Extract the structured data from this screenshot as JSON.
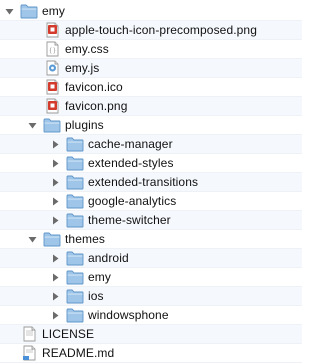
{
  "tree": {
    "rows": [
      {
        "name": "emy",
        "type": "folder",
        "expanded": true,
        "depth": 0
      },
      {
        "name": "apple-touch-icon-precomposed.png",
        "type": "png",
        "depth": 1
      },
      {
        "name": "emy.css",
        "type": "css",
        "depth": 1
      },
      {
        "name": "emy.js",
        "type": "js",
        "depth": 1
      },
      {
        "name": "favicon.ico",
        "type": "ico",
        "depth": 1
      },
      {
        "name": "favicon.png",
        "type": "png",
        "depth": 1
      },
      {
        "name": "plugins",
        "type": "folder",
        "expanded": true,
        "depth": 1
      },
      {
        "name": "cache-manager",
        "type": "folder",
        "expanded": false,
        "depth": 2
      },
      {
        "name": "extended-styles",
        "type": "folder",
        "expanded": false,
        "depth": 2
      },
      {
        "name": "extended-transitions",
        "type": "folder",
        "expanded": false,
        "depth": 2
      },
      {
        "name": "google-analytics",
        "type": "folder",
        "expanded": false,
        "depth": 2
      },
      {
        "name": "theme-switcher",
        "type": "folder",
        "expanded": false,
        "depth": 2
      },
      {
        "name": "themes",
        "type": "folder",
        "expanded": true,
        "depth": 1
      },
      {
        "name": "android",
        "type": "folder",
        "expanded": false,
        "depth": 2
      },
      {
        "name": "emy",
        "type": "folder",
        "expanded": false,
        "depth": 2
      },
      {
        "name": "ios",
        "type": "folder",
        "expanded": false,
        "depth": 2
      },
      {
        "name": "windowsphone",
        "type": "folder",
        "expanded": false,
        "depth": 2
      },
      {
        "name": "LICENSE",
        "type": "text",
        "depth": 0
      },
      {
        "name": "README.md",
        "type": "markdown",
        "depth": 0
      }
    ]
  },
  "icons": {
    "folder": "folder-icon",
    "png": "png-image-icon",
    "ico": "ico-image-icon",
    "css": "css-document-icon",
    "js": "js-script-icon",
    "text": "text-document-icon",
    "markdown": "markdown-document-icon",
    "expanded": "disclosure-triangle-expanded-icon",
    "collapsed": "disclosure-triangle-collapsed-icon"
  },
  "colors": {
    "folder_fill": "#9fc6e9",
    "folder_stroke": "#5f95c8",
    "image_badge": "#d33a2c",
    "triangle": "#6b6b6b"
  }
}
